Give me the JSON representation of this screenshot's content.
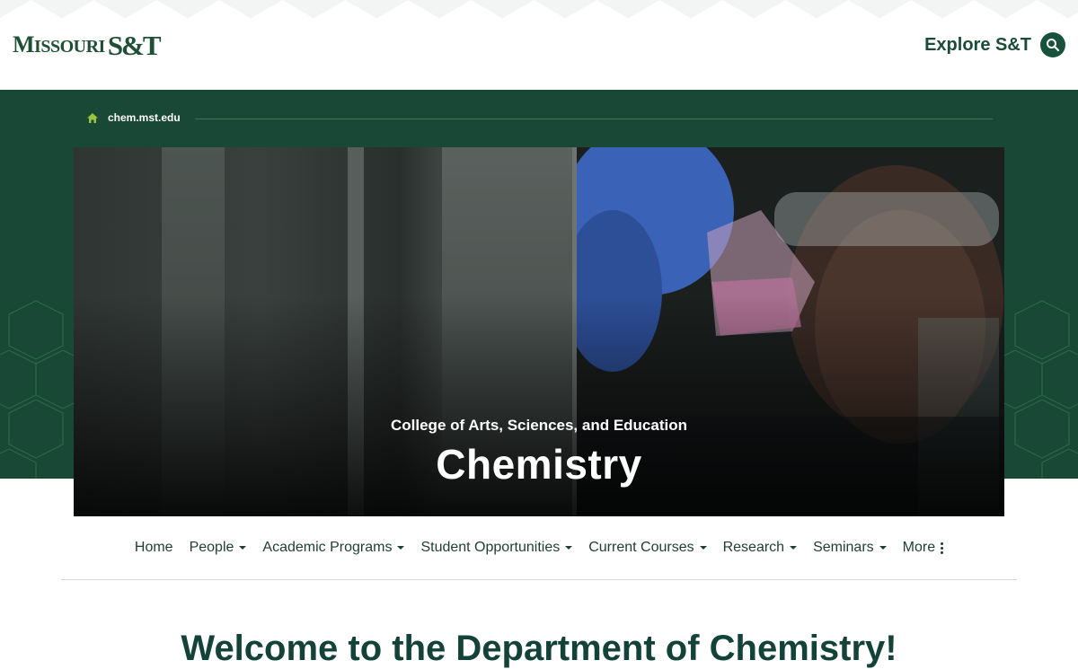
{
  "header": {
    "logo_word_first": "M",
    "logo_word_rest": "ISSOURI",
    "logo_mark": "S&T",
    "explore_label": "Explore S&T",
    "search_icon": "search-icon"
  },
  "breadcrumb": {
    "icon": "home-icon",
    "label": "chem.mst.edu"
  },
  "hero": {
    "subtitle": "College of Arts, Sciences, and Education",
    "title": "Chemistry"
  },
  "nav": {
    "items": [
      {
        "label": "Home"
      },
      {
        "label": "People"
      },
      {
        "label": "Academic Programs"
      },
      {
        "label": "Student Opportunities"
      },
      {
        "label": "Current Courses"
      },
      {
        "label": "Research"
      },
      {
        "label": "Seminars"
      },
      {
        "label": "More"
      }
    ]
  },
  "main": {
    "heading": "Welcome to the Department of Chemistry!"
  },
  "colors": {
    "brand_green": "#194936",
    "accent_lime": "#9ac43c",
    "text_dark": "#1e3d33"
  }
}
